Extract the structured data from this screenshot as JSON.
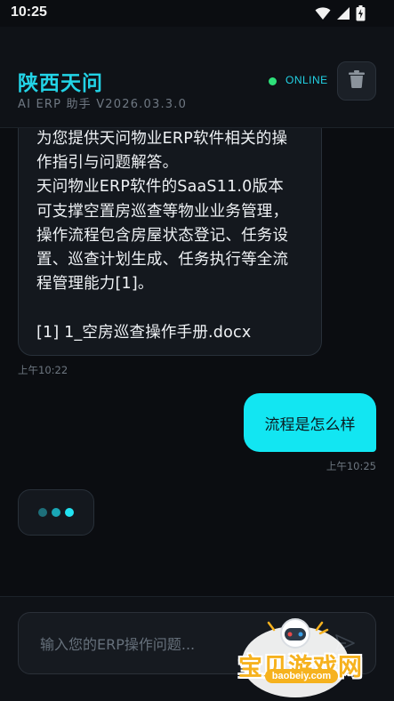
{
  "status_bar": {
    "time": "10:25",
    "icons": [
      "wifi-icon",
      "cellular-icon",
      "battery-icon"
    ]
  },
  "header": {
    "title": "陕西天问",
    "subtitle": "AI ERP 助手 V2026.03.3.0",
    "status_label": "ONLINE",
    "delete_icon": "trash-icon"
  },
  "colors": {
    "accent": "#22d3e6",
    "user_bubble": "#12e6f2",
    "online": "#2ee07a",
    "background": "#0b0d11"
  },
  "messages": [
    {
      "role": "assistant",
      "text": "为您提供天问物业ERP软件相关的操\n作指引与问题解答。\n天问物业ERP软件的SaaS11.0版本\n可支撑空置房巡查等物业业务管理，\n操作流程包含房屋状态登记、任务设\n置、巡查计划生成、任务执行等全流\n程管理能力[1]。\n\n[1] 1_空房巡查操作手册.docx",
      "time": "上午10:22"
    },
    {
      "role": "user",
      "text": "流程是怎么样",
      "time": "上午10:25"
    }
  ],
  "typing_indicator": {
    "dot_colors": [
      "#1e6f7a",
      "#1aa6b5",
      "#22e3f2"
    ]
  },
  "composer": {
    "placeholder": "输入您的ERP操作问题...",
    "value": "",
    "send_icon": "send-icon"
  },
  "watermark": {
    "text": "宝贝游戏网",
    "url": "baobeiy.com"
  }
}
